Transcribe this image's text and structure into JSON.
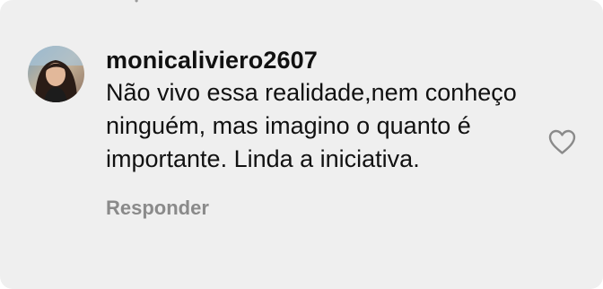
{
  "comment": {
    "username": "monicaliviero2607",
    "text": "Não vivo essa realidade,nem conheço ninguém, mas imagino o quanto é importante. Linda a iniciativa.",
    "reply_label": "Responder",
    "avatar_icon": "user-avatar",
    "like_icon": "heart-outline-icon",
    "colors": {
      "card_background": "#efefef",
      "text": "#111111",
      "secondary_text": "#8a8a8a"
    }
  }
}
